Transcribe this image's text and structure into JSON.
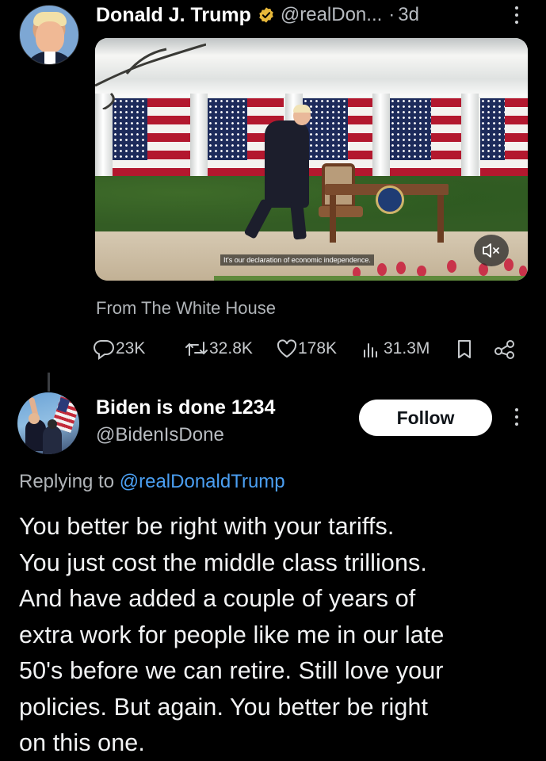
{
  "tweet": {
    "author_name": "Donald J. Trump",
    "verified_icon": "gold-verified-badge-icon",
    "handle": "@realDon...",
    "separator": "·",
    "age": "3d",
    "media": {
      "caption": "It's our declaration of economic independence.",
      "mute_icon": "speaker-muted-icon"
    },
    "source": "From The White House",
    "stats": {
      "replies": "23K",
      "reposts": "32.8K",
      "likes": "178K",
      "views": "31.3M"
    },
    "icons": [
      "reply-icon",
      "repost-icon",
      "like-icon",
      "views-icon",
      "bookmark-icon",
      "share-icon",
      "more-icon"
    ]
  },
  "reply": {
    "author_name": "Biden is done 1234",
    "handle": "@BidenIsDone",
    "follow_label": "Follow",
    "replying_prefix": "Replying to",
    "replying_to": "@realDonaldTrump",
    "lines": [
      "You better be right with your tariffs.",
      "You just cost the middle class trillions.",
      "And have added a couple of years of",
      "extra work for people like me in our late",
      "50's before we can retire. Still love your",
      "policies. But again. You better be right",
      "on this one."
    ]
  },
  "colors": {
    "background": "#000000",
    "link": "#4b9ff2",
    "secondary_text": "#b8bcc1",
    "verified_gold": "#e8b83a"
  }
}
